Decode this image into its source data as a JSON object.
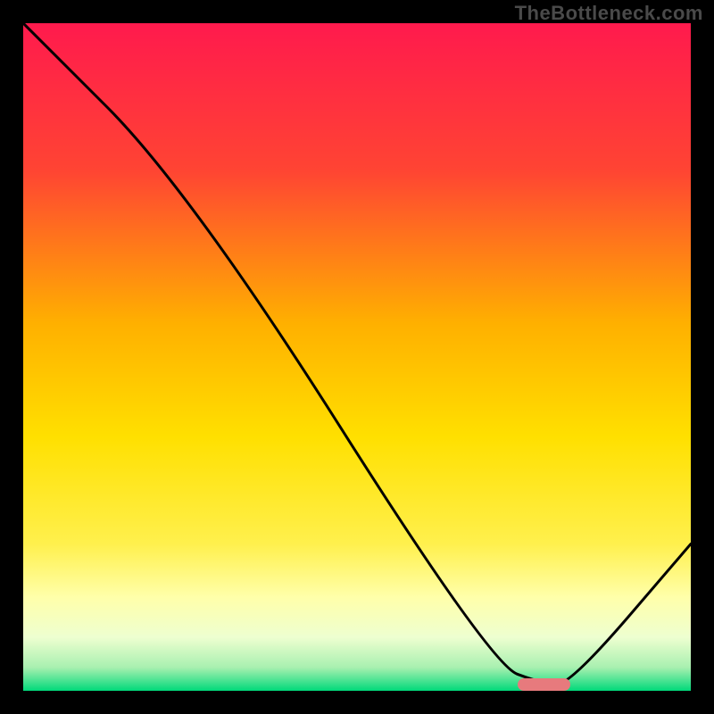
{
  "watermark": "TheBottleneck.com",
  "chart_data": {
    "type": "line",
    "title": "",
    "xlabel": "",
    "ylabel": "",
    "xlim": [
      0,
      100
    ],
    "ylim": [
      0,
      100
    ],
    "grid": false,
    "legend": false,
    "series": [
      {
        "name": "bottleneck-curve",
        "x": [
          0,
          25,
          70,
          78,
          82,
          100
        ],
        "values": [
          100,
          75,
          4,
          1,
          1,
          22
        ]
      }
    ],
    "optimal_marker": {
      "x_start": 74,
      "x_end": 82,
      "y": 1
    },
    "background_gradient": {
      "stops": [
        {
          "offset": 0,
          "color": "#ff1a4d"
        },
        {
          "offset": 22,
          "color": "#ff4433"
        },
        {
          "offset": 45,
          "color": "#ffb000"
        },
        {
          "offset": 62,
          "color": "#ffe000"
        },
        {
          "offset": 78,
          "color": "#fff04d"
        },
        {
          "offset": 86,
          "color": "#ffffaa"
        },
        {
          "offset": 92,
          "color": "#eeffd0"
        },
        {
          "offset": 96.5,
          "color": "#a8f0b0"
        },
        {
          "offset": 100,
          "color": "#00d97a"
        }
      ]
    }
  }
}
